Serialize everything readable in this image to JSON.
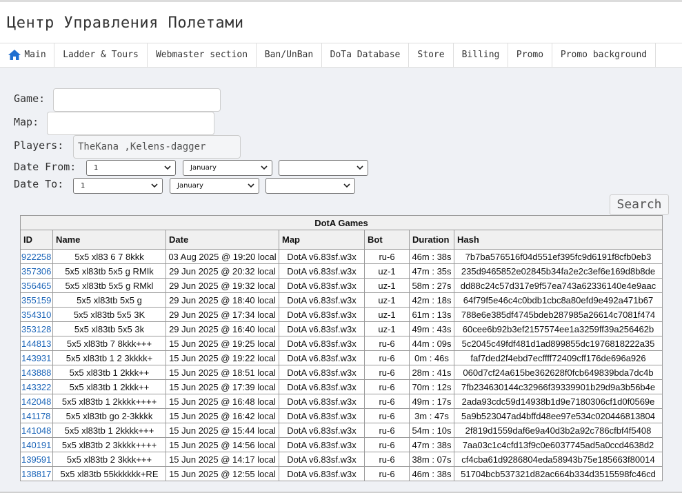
{
  "site_title": "Центр Управления Полетами",
  "nav": [
    {
      "label": "Main",
      "icon": "home-icon"
    },
    {
      "label": "Ladder & Tours"
    },
    {
      "label": "Webmaster section"
    },
    {
      "label": "Ban/UnBan"
    },
    {
      "label": "DoTa Database"
    },
    {
      "label": "Store"
    },
    {
      "label": "Billing"
    },
    {
      "label": "Promo"
    },
    {
      "label": "Promo background"
    }
  ],
  "filters": {
    "game_label": "Game:",
    "game_value": "",
    "map_label": "Map:",
    "map_value": "",
    "players_label": "Players:",
    "players_value": "TheKana ,Kelens-dagger",
    "date_from_label": "Date From:",
    "date_to_label": "Date To:",
    "date_from": {
      "day": "1",
      "month": "January",
      "year": ""
    },
    "date_to": {
      "day": "1",
      "month": "January",
      "year": ""
    },
    "search_label": "Search"
  },
  "table": {
    "caption": "DotA Games",
    "headers": [
      "ID",
      "Name",
      "Date",
      "Map",
      "Bot",
      "Duration",
      "Hash"
    ],
    "rows": [
      [
        "922258",
        "5x5 xl83 6 7 8kkk",
        "03 Aug 2025 @ 19:20 local",
        "DotA v6.83sf.w3x",
        "ru-6",
        "46m : 38s",
        "7b7ba576516f04d551ef395fc9d6191f8cfb0eb3"
      ],
      [
        "357306",
        "5x5 xl83tb 5x5 g RMIk",
        "29 Jun 2025 @ 20:32 local",
        "DotA v6.83sf.w3x",
        "uz-1",
        "47m : 35s",
        "235d9465852e02845b34fa2e2c3ef6e169d8b8de"
      ],
      [
        "356465",
        "5x5 xl83tb 5x5 g RMkl",
        "29 Jun 2025 @ 19:32 local",
        "DotA v6.83sf.w3x",
        "uz-1",
        "58m : 27s",
        "dd88c24c57d317e9f57ea743a62336140e4e9aac"
      ],
      [
        "355159",
        "5x5 xl83tb 5x5 g",
        "29 Jun 2025 @ 18:40 local",
        "DotA v6.83sf.w3x",
        "uz-1",
        "42m : 18s",
        "64f79f5e46c4c0bdb1cbc8a80efd9e492a471b67"
      ],
      [
        "354310",
        "5x5 xl83tb 5x5 3K",
        "29 Jun 2025 @ 17:34 local",
        "DotA v6.83sf.w3x",
        "uz-1",
        "61m : 13s",
        "788e6e385df4745bdeb287985a26614c7081f474"
      ],
      [
        "353128",
        "5x5 xl83tb 5x5 3k",
        "29 Jun 2025 @ 16:40 local",
        "DotA v6.83sf.w3x",
        "uz-1",
        "49m : 43s",
        "60cee6b92b3ef2157574ee1a3259ff39a256462b"
      ],
      [
        "144813",
        "5x5 xl83tb 7 8kkk+++",
        "15 Jun 2025 @ 19:25 local",
        "DotA v6.83sf.w3x",
        "ru-6",
        "44m : 09s",
        "5c2045c49fdf481d1ad899855dc1976818222a35"
      ],
      [
        "143931",
        "5x5 xl83tb 1 2 3kkkk+",
        "15 Jun 2025 @ 19:22 local",
        "DotA v6.83sf.w3x",
        "ru-6",
        "0m : 46s",
        "faf7ded2f4ebd7ecffff72409cff176de696a926"
      ],
      [
        "143888",
        "5x5 xl83tb 1 2kkk++",
        "15 Jun 2025 @ 18:51 local",
        "DotA v6.83sf.w3x",
        "ru-6",
        "28m : 41s",
        "060d7cf24a615be362628f0fcb649839bda7dc4b"
      ],
      [
        "143322",
        "5x5 xl83tb 1 2kkk++",
        "15 Jun 2025 @ 17:39 local",
        "DotA v6.83sf.w3x",
        "ru-6",
        "70m : 12s",
        "7fb234630144c32966f39339901b29d9a3b56b4e"
      ],
      [
        "142048",
        "5x5 xl83tb 1 2kkkk++++",
        "15 Jun 2025 @ 16:48 local",
        "DotA v6.83sf.w3x",
        "ru-6",
        "49m : 17s",
        "2ada93cdc59d14938b1d9e7180306cf1d0f0569e"
      ],
      [
        "141178",
        "5x5 xl83tb go 2-3kkkk",
        "15 Jun 2025 @ 16:42 local",
        "DotA v6.83sf.w3x",
        "ru-6",
        "3m : 47s",
        "5a9b523047ad4bffd48ee97e534c020446813804"
      ],
      [
        "141048",
        "5x5 xl83tb 1 2kkkk+++",
        "15 Jun 2025 @ 15:44 local",
        "DotA v6.83sf.w3x",
        "ru-6",
        "54m : 10s",
        "2f819d1559daf6e9a40d3b2a92c786cfbf4f5408"
      ],
      [
        "140191",
        "5x5 xl83tb 2 3kkkk++++",
        "15 Jun 2025 @ 14:56 local",
        "DotA v6.83sf.w3x",
        "ru-6",
        "47m : 38s",
        "7aa03c1c4cfd13f9c0e6037745ad5a0ccd4638d2"
      ],
      [
        "139591",
        "5x5 xl83tb 2 3kkk+++",
        "15 Jun 2025 @ 14:17 local",
        "DotA v6.83sf.w3x",
        "ru-6",
        "38m : 07s",
        "cf4cba61d9286804eda58943b75e185663f80014"
      ],
      [
        "138817",
        "5x5 xl83tb 55kkkkkk+RE",
        "15 Jun 2025 @ 12:55 local",
        "DotA v6.83sf.w3x",
        "ru-6",
        "46m : 38s",
        "51704bcb537321d82ac664b334d3515598fc46cd"
      ]
    ]
  },
  "colors": {
    "link": "#1a64b8",
    "home_icon": "#1f6fd0",
    "page_bg": "#eff1f5"
  }
}
